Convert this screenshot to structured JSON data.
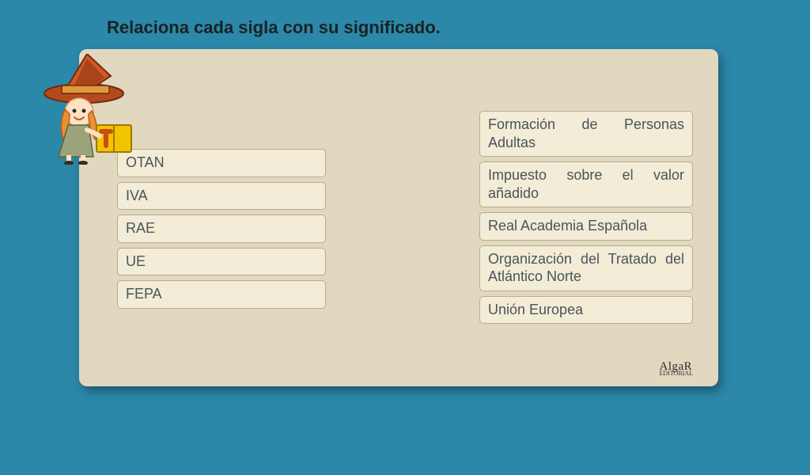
{
  "title": "Relaciona cada sigla con su significado.",
  "left_items": [
    "OTAN",
    "IVA",
    "RAE",
    "UE",
    "FEPA"
  ],
  "right_items": [
    "Formación de Personas Adultas",
    "Impuesto sobre el valor añadido",
    "Real Academia Española",
    "Organización del Tratado del Atlántico Norte",
    "Unión Europea"
  ],
  "footer_logo": "AlgaR"
}
